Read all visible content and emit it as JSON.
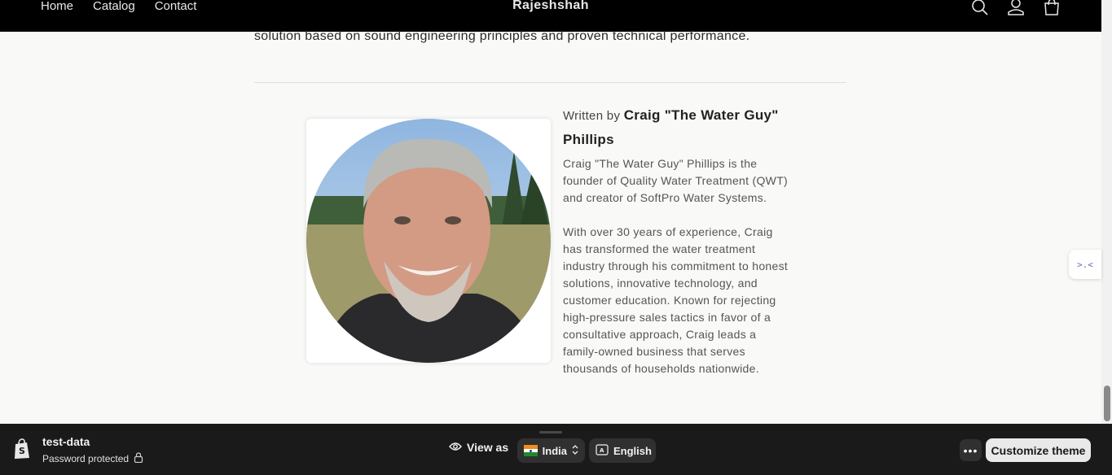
{
  "header": {
    "nav": [
      "Home",
      "Catalog",
      "Contact"
    ],
    "brand": "Rajeshshah",
    "icons": [
      "search-icon",
      "account-icon",
      "cart-icon"
    ]
  },
  "article": {
    "lead_text": "solution based on sound engineering principles and proven technical performance.",
    "author": {
      "written_by": "Written by ",
      "name": "Craig \"The Water Guy\" Phillips",
      "bio_paragraph_1": "Craig \"The Water Guy\" Phillips is the founder of Quality Water Treatment (QWT) and creator of SoftPro Water Systems.",
      "bio_paragraph_2": "With over 30 years of experience, Craig has transformed the water treatment industry through his commitment to honest solutions, innovative technology, and customer education.  Known for rejecting high-pressure sales tactics in favor of a consultative approach, Craig leads a family-owned business that serves thousands of households nationwide."
    }
  },
  "side_widget": {
    "glyph": ">.<"
  },
  "bottom_bar": {
    "store_name": "test-data",
    "store_status": "Password protected",
    "view_as_label": "View as",
    "country": "India",
    "language": "English",
    "customize_label": "Customize theme"
  },
  "colors": {
    "header_bg": "#000000",
    "page_bg": "#f9f9f7",
    "bottom_bar_bg": "#1a1a1a"
  }
}
